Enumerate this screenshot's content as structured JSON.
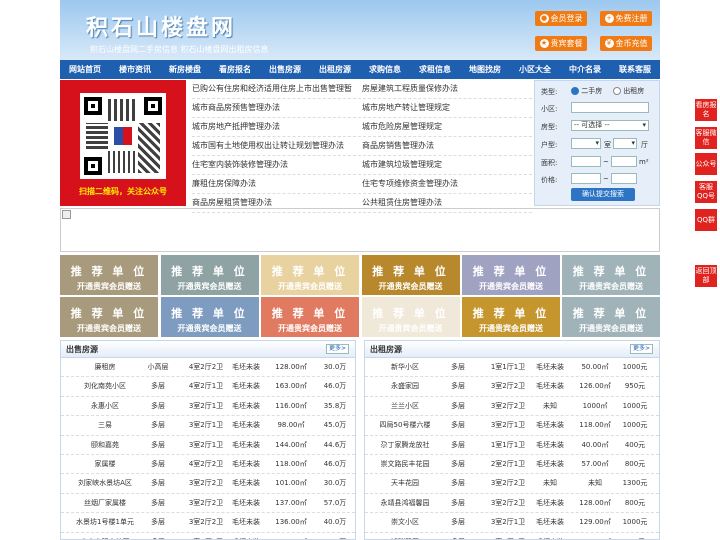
{
  "header": {
    "logo": "积石山楼盘网",
    "slogan": "积石山楼盘网二手房信息   积石山楼盘网出租房信息",
    "buttons": [
      "会员登录",
      "免费注册",
      "贵宾套餐",
      "金币充值"
    ]
  },
  "nav": [
    "网站首页",
    "楼市资讯",
    "新房楼盘",
    "看房报名",
    "出售房源",
    "出租房源",
    "求购信息",
    "求租信息",
    "地图找房",
    "小区大全",
    "中介名录",
    "联系客服"
  ],
  "qr": {
    "caption": "扫描二维码，关注公众号"
  },
  "links": [
    [
      "已购公有住房和经济适用住房上市出售管理暂",
      "房屋建筑工程质量保修办法"
    ],
    [
      "城市商品房预售管理办法",
      "城市房地产转让管理规定"
    ],
    [
      "城市房地产抵押管理办法",
      "城市危险房屋管理规定"
    ],
    [
      "城市国有土地使用权出让转让规划管理办法",
      "商品房销售管理办法"
    ],
    [
      "住宅室内装饰装修管理办法",
      "城市建筑垃圾管理规定"
    ],
    [
      "廉租住房保障办法",
      "住宅专项维修资金管理办法"
    ],
    [
      "商品房屋租赁管理办法",
      "公共租赁住房管理办法"
    ]
  ],
  "search": {
    "type_label": "类型:",
    "type_options": [
      "二手房",
      "出租房"
    ],
    "community_label": "小区:",
    "house_label": "房型:",
    "house_select": "-- 可选择 --",
    "layout_label": "户型:",
    "layout_room": "室",
    "layout_hall": "厅",
    "area_label": "面积:",
    "area_unit": "m²",
    "area_sep": "~",
    "price_label": "价格:",
    "price_sep": "~",
    "submit": "确认提交搜索"
  },
  "recommend": {
    "title": "推 荐 单 位",
    "sub": "开通贵宾会员赠送"
  },
  "rec_colors": [
    "#a89a7c",
    "#8fa3a4",
    "#e8d2a0",
    "#b8882c",
    "#9fa2c0",
    "#9fb3b8",
    "#a89a7c",
    "#7d9cc0",
    "#e07a60",
    "#f0e8d8",
    "#c5962e",
    "#9fb3b8"
  ],
  "sale": {
    "title": "出售房源",
    "more": "更多>",
    "rows": [
      [
        "廉租房",
        "小高层",
        "4室2厅2卫",
        "毛坯未装",
        "128.00㎡",
        "30.0万"
      ],
      [
        "刘化南苑小区",
        "多层",
        "4室2厅1卫",
        "毛坯未装",
        "163.00㎡",
        "46.0万"
      ],
      [
        "永惠小区",
        "多层",
        "3室2厅1卫",
        "毛坯未装",
        "116.00㎡",
        "35.8万"
      ],
      [
        "三易",
        "多层",
        "3室2厅1卫",
        "毛坯未装",
        "98.00㎡",
        "45.0万"
      ],
      [
        "颐和嘉苑",
        "多层",
        "3室2厅1卫",
        "毛坯未装",
        "144.00㎡",
        "44.6万"
      ],
      [
        "家属楼",
        "多层",
        "4室2厅2卫",
        "毛坯未装",
        "118.00㎡",
        "46.0万"
      ],
      [
        "刘家峡水景坊A区",
        "多层",
        "3室2厅2卫",
        "毛坯未装",
        "101.00㎡",
        "30.0万"
      ],
      [
        "丝烟厂家属楼",
        "多层",
        "3室2厅2卫",
        "毛坯未装",
        "137.00㎡",
        "57.0万"
      ],
      [
        "水景坊1号楼1单元",
        "多层",
        "3室2厅2卫",
        "毛坯未装",
        "136.00㎡",
        "40.0万"
      ],
      [
        "小十字明丰花园",
        "多层",
        "3室2厅1卫",
        "毛坯未装",
        "115.00㎡",
        "45.5万"
      ]
    ]
  },
  "rent": {
    "title": "出租房源",
    "more": "更多>",
    "rows": [
      [
        "新华小区",
        "多层",
        "1室1厅1卫",
        "毛坯未装",
        "50.00㎡",
        "1000元"
      ],
      [
        "永盛家园",
        "多层",
        "3室2厅2卫",
        "毛坯未装",
        "126.00㎡",
        "950元"
      ],
      [
        "兰兰小区",
        "多层",
        "3室2厅2卫",
        "未知",
        "1000㎡",
        "1000元"
      ],
      [
        "四局50号楼六楼",
        "多层",
        "3室2厅1卫",
        "毛坯未装",
        "118.00㎡",
        "1000元"
      ],
      [
        "尕丁家腾龙放社",
        "多层",
        "1室1厅1卫",
        "毛坯未装",
        "40.00㎡",
        "400元"
      ],
      [
        "崇文路民丰花园",
        "多层",
        "2室2厅1卫",
        "毛坯未装",
        "57.00㎡",
        "800元"
      ],
      [
        "天丰花园",
        "多层",
        "3室2厅2卫",
        "未知",
        "未知",
        "1300元"
      ],
      [
        "永靖县鸿福馨园",
        "多层",
        "3室2厅2卫",
        "毛坯未装",
        "128.00㎡",
        "800元"
      ],
      [
        "崇文小区",
        "多层",
        "3室2厅1卫",
        "毛坯未装",
        "129.00㎡",
        "1000元"
      ],
      [
        "鸿瑞馨园",
        "多层",
        "3室2厅1卫",
        "毛坯未装",
        "128.00㎡",
        "900元"
      ]
    ]
  },
  "float": [
    "看房报名",
    "客服微信",
    "公众号",
    "客服QQ号",
    "QQ群",
    "返回顶部"
  ],
  "colors": {
    "nav": "#1f5fb0",
    "accent": "#f07b14",
    "float": "#e0231e"
  }
}
